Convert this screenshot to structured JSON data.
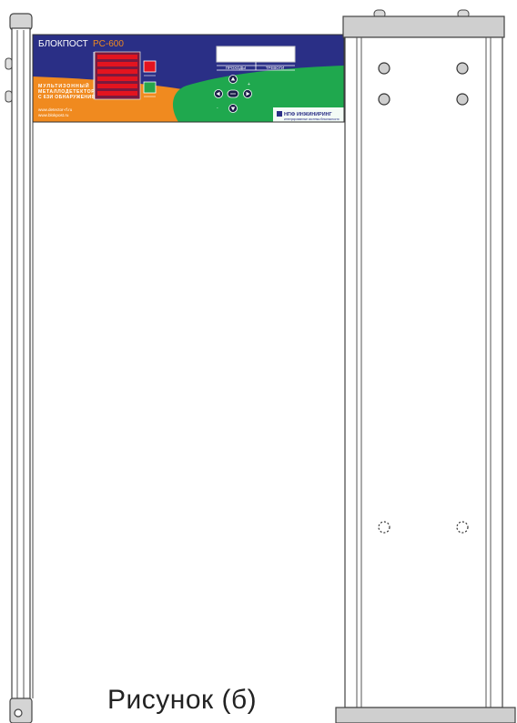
{
  "panel": {
    "brand": "БЛОКПОСТ",
    "model": "PC-600",
    "tagline": [
      "МУЛЬТИЗОННЫЙ",
      "МЕТАЛЛОДЕТЕКТОР",
      "С 6ЗИ ОБНАРУЖЕНИЯ"
    ],
    "websites": [
      "www.detector-rf.ru",
      "www.blokpost.ru"
    ],
    "counter_labels": [
      "ПРОХОДЫ",
      "ТРЕВОГИ"
    ],
    "manufacturer": "НПФ ИНЖИНИРИНГ",
    "manufacturer_sub": "интегрированные системы безопасности",
    "colors": {
      "panel_blue": "#2a2f86",
      "panel_orange": "#f08a1f",
      "panel_green": "#1fa84e",
      "alarm_red": "#e3141f",
      "ok_green": "#27a54a",
      "frame_gray": "#cfcfcf"
    }
  },
  "caption": "Рисунок (б)"
}
